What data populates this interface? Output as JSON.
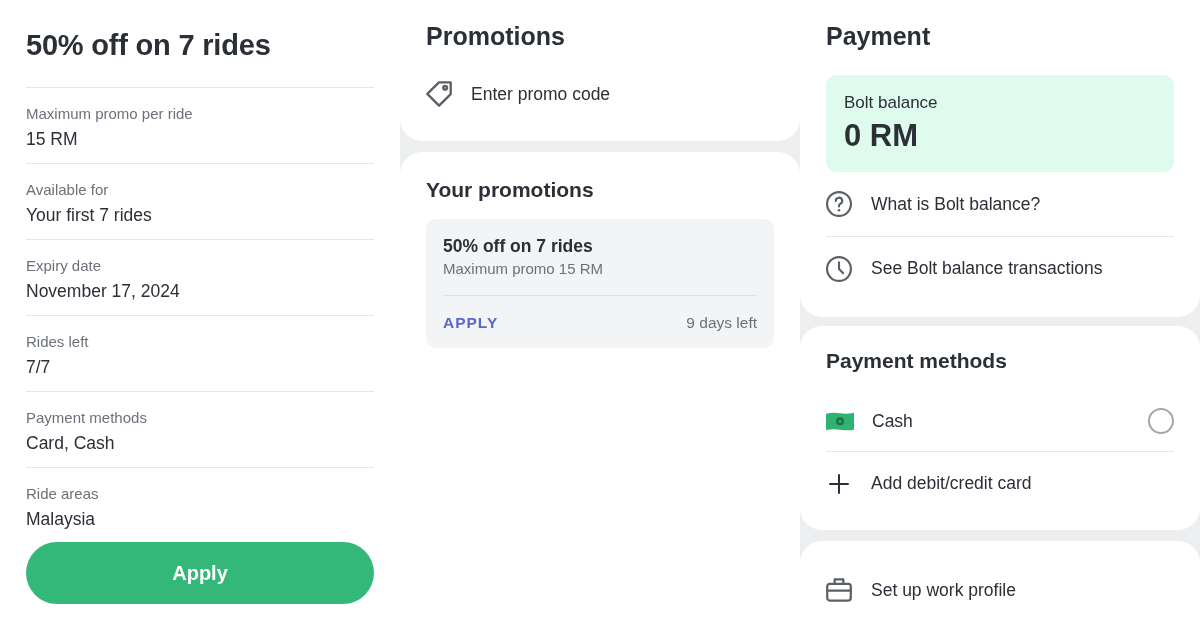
{
  "offer_details": {
    "title": "50% off on 7 rides",
    "details": [
      {
        "label": "Maximum promo per ride",
        "value": "15 RM"
      },
      {
        "label": "Available for",
        "value": "Your first 7 rides"
      },
      {
        "label": "Expiry date",
        "value": "November 17, 2024"
      },
      {
        "label": "Rides left",
        "value": "7/7"
      },
      {
        "label": "Payment methods",
        "value": "Card, Cash"
      },
      {
        "label": "Ride areas",
        "value": "Malaysia"
      }
    ],
    "apply_button": "Apply"
  },
  "promotions": {
    "title": "Promotions",
    "promo_code_entry": "Enter promo code"
  },
  "your_promotions": {
    "title": "Your promotions",
    "items": [
      {
        "title": "50% off on 7 rides",
        "subtitle": "Maximum promo 15 RM",
        "action": "APPLY",
        "time_left": "9 days left"
      }
    ]
  },
  "payment": {
    "title": "Payment",
    "balance": {
      "label": "Bolt balance",
      "amount": "0 RM"
    },
    "links": [
      {
        "kind": "help",
        "label": "What is Bolt balance?"
      },
      {
        "kind": "history",
        "label": "See Bolt balance transactions"
      }
    ]
  },
  "payment_methods": {
    "title": "Payment methods",
    "methods": [
      {
        "kind": "cash",
        "label": "Cash",
        "selected": false
      }
    ],
    "add_card": "Add debit/credit card"
  },
  "work_profile": {
    "label": "Set up work profile"
  }
}
